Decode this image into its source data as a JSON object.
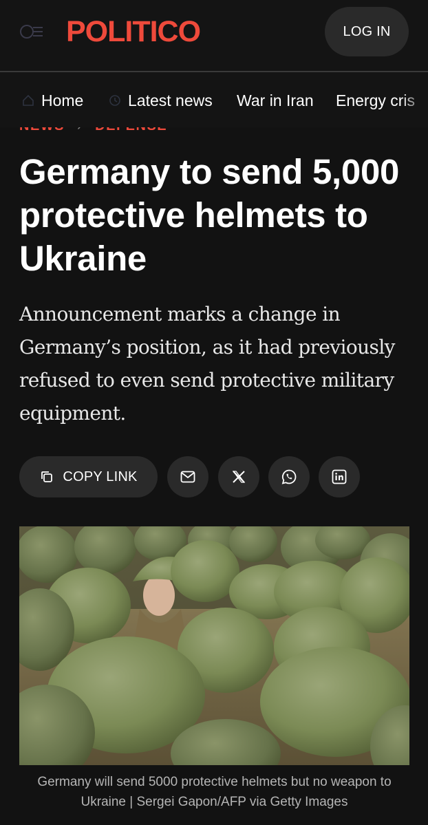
{
  "header": {
    "logo": "POLITICO",
    "login_label": "LOG IN"
  },
  "nav": {
    "items": [
      {
        "label": "Home",
        "icon": "home-icon"
      },
      {
        "label": "Latest news",
        "icon": "clock-icon"
      },
      {
        "label": "War in Iran"
      },
      {
        "label": "Energy cris"
      }
    ]
  },
  "breadcrumb": {
    "section": "NEWS",
    "subsection": "DEFENSE"
  },
  "article": {
    "headline": "Germany to send 5,000 protective helmets to Ukraine",
    "dek": "Announcement marks a change in Germany’s position, as it had previously refused to even send protective military equipment.",
    "image_caption": "Germany will send 5000 protective helmets but no weapon to Ukraine | Sergei Gapon/AFP via Getty Images"
  },
  "share": {
    "copy_link_label": "COPY LINK",
    "icons": [
      "mail-icon",
      "x-icon",
      "whatsapp-icon",
      "linkedin-icon"
    ]
  },
  "colors": {
    "brand": "#ee4a3b",
    "background": "#121212",
    "button": "#2a2a2a",
    "helmet": "#7a8a55"
  }
}
